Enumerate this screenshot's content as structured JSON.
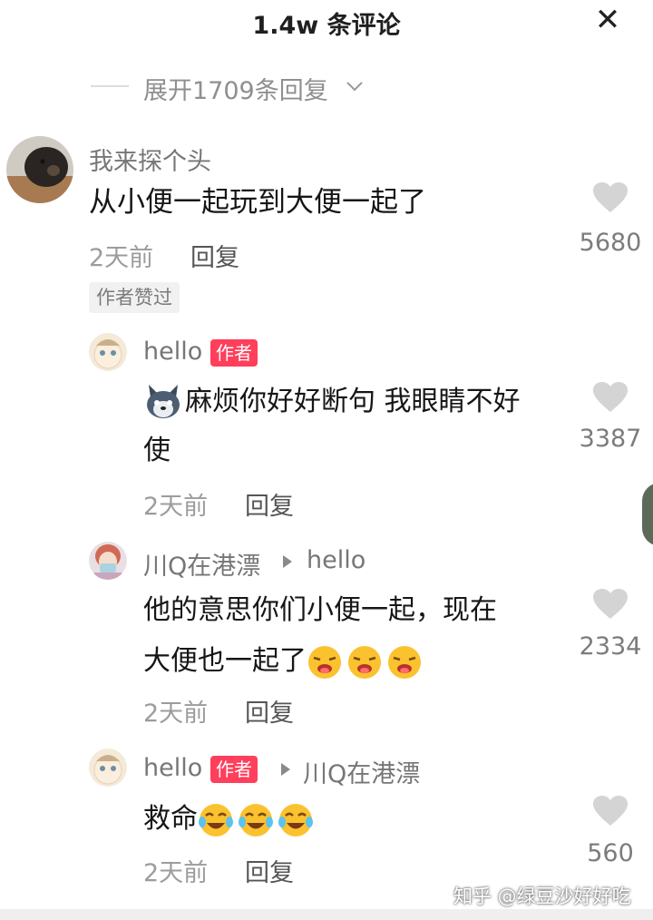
{
  "header": {
    "title": "1.4w 条评论",
    "close_icon": "close-icon"
  },
  "expand": {
    "label": "展开1709条回复"
  },
  "comment": {
    "username": "我来探个头",
    "text": "从小便一起玩到大便一起了",
    "time": "2天前",
    "reply_label": "回复",
    "likes": "5680",
    "liked_by_author": "作者赞过"
  },
  "replies": [
    {
      "username": "hello",
      "badge": "作者",
      "line1": "麻烦你好好断句 我眼睛不好",
      "line2": "使",
      "time": "2天前",
      "reply_label": "回复",
      "likes": "3387"
    },
    {
      "username": "川Q在港漂",
      "reply_to": "hello",
      "line1": "他的意思你们小便一起，现在",
      "line2": "大便也一起了",
      "time": "2天前",
      "reply_label": "回复",
      "likes": "2334"
    },
    {
      "username": "hello",
      "badge": "作者",
      "reply_to": "川Q在港漂",
      "line1": "救命",
      "time": "2天前",
      "reply_label": "回复",
      "likes": "560"
    }
  ],
  "watermark": "知乎 @绿豆沙好好吃",
  "colors": {
    "badge": "#ff3f5c",
    "meta": "#9c9c9c",
    "heart": "#d4d4d4"
  }
}
